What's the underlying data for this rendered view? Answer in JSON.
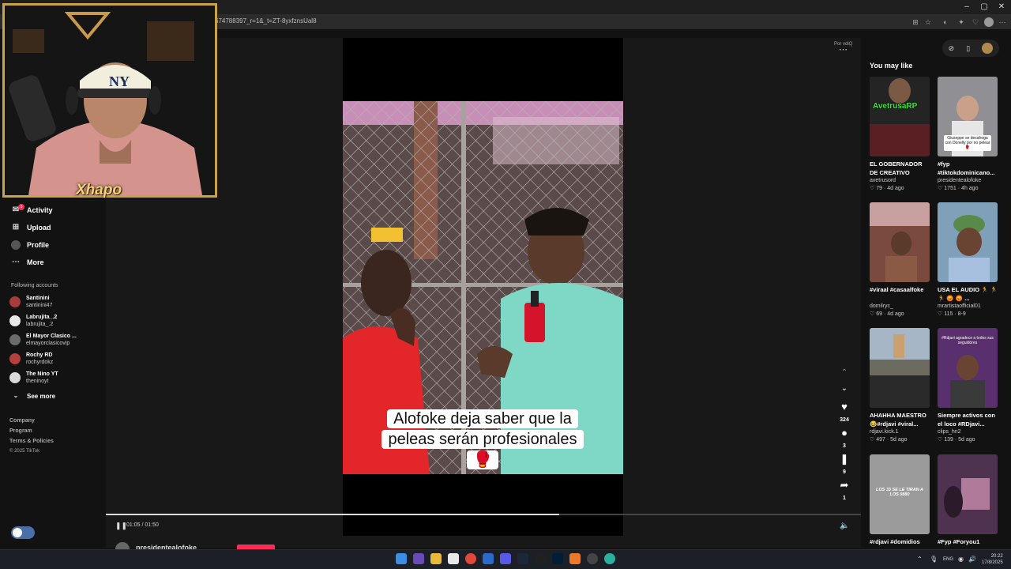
{
  "browser": {
    "url": "674788397_r=1&_t=ZT-8yxfznsUal8",
    "window_controls": [
      "–",
      "▢",
      "✕"
    ]
  },
  "webcam": {
    "streamer_name": "Xhapo"
  },
  "sidebar": {
    "nav": [
      {
        "label": "Activity",
        "icon": "inbox-icon",
        "badge": "3"
      },
      {
        "label": "Upload",
        "icon": "plus-square-icon"
      },
      {
        "label": "Profile",
        "icon": "profile-icon"
      },
      {
        "label": "More",
        "icon": "more-dots-icon"
      }
    ],
    "following_title": "Following accounts",
    "accounts": [
      {
        "name": "Santinini",
        "handle": "santinini47",
        "color": "#a83c3c"
      },
      {
        "name": "Labrujita_.2",
        "handle": "labrujita_.2",
        "color": "#e8e8e8"
      },
      {
        "name": "El Mayor Clasico ...",
        "handle": "elmayorclasicovip",
        "color": "#6b6b6b"
      },
      {
        "name": "Rochy RD",
        "handle": "rochyrdokz",
        "color": "#b5413d"
      },
      {
        "name": "The Nino YT",
        "handle": "theninoyt",
        "color": "#d9d9d9"
      }
    ],
    "see_more": "See more",
    "footer": [
      "Company",
      "Program",
      "Terms & Policies",
      "© 2025 TikTok"
    ]
  },
  "video": {
    "caption": "Alofoke deja saber que la peleas serán profesionales 🥊",
    "time": "01:05 / 01:50",
    "progress": 0.6,
    "author": "presidentealofoke",
    "provider": "Por vdiQ",
    "counts": {
      "likes": "324",
      "comments": "3",
      "saves": "9",
      "shares": "1"
    }
  },
  "right_panel": {
    "title": "You may like",
    "cards": [
      {
        "title": "EL GOBERNADOR DE CREATIVO QUIEN E...",
        "user": "avetrusord",
        "likes": "79",
        "age": "4d ago",
        "bg": "#2a2a2a",
        "thumb_text": "AvetrusaRP",
        "thumb_color": "#3be03b"
      },
      {
        "title": "#fyp #tiktokdominicano...",
        "user": "presidentealofoke",
        "likes": "1751",
        "age": "4h ago",
        "bg": "#8f8f94",
        "thumb_text": "Giuseppe se desahoga con Donelly por no pelear 🥊",
        "thumb_color": "#111111"
      },
      {
        "title": "#viraal #casaalfoke",
        "user": "domilryc_",
        "likes": "69",
        "age": "4d ago",
        "bg": "#7a4a3e",
        "thumb_text": "",
        "thumb_color": "#ffffff"
      },
      {
        "title": "USA EL AUDIO 🏃 🏃 🏃 😡 😡 ...",
        "user": "mrartistaofficial01",
        "likes": "115",
        "age": "8-9",
        "bg": "#7fa0b8",
        "thumb_text": "",
        "thumb_color": "#ffffff"
      },
      {
        "title": "AHAHHA MAESTRO 😂#rdjavi #viral...",
        "user": "rdjavi.kick.1",
        "likes": "497",
        "age": "5d ago",
        "bg": "#6d6a60",
        "thumb_text": "",
        "thumb_color": "#ffffff"
      },
      {
        "title": "Siempre activos con el loco #RDjavi...",
        "user": "clips_hn2",
        "likes": "139",
        "age": "5d ago",
        "bg": "#5a2f6e",
        "thumb_text": "#Rdjavi agradece a todos sus seguidores",
        "thumb_color": "#ffffff"
      },
      {
        "title": "#rdjavi #domidios",
        "user": "",
        "likes": "",
        "age": "",
        "bg": "#9b9b9b",
        "thumb_text": "LOS 33 SE LE TIRAN A LOS 0880",
        "thumb_color": "#ffffff"
      },
      {
        "title": "#Fyp #Foryou1",
        "user": "",
        "likes": "",
        "age": "",
        "bg": "#4e3250",
        "thumb_text": "",
        "thumb_color": "#ffffff"
      }
    ]
  },
  "taskbar": {
    "lang": "ENG",
    "time": "20:22",
    "date": "17/8/2025"
  }
}
